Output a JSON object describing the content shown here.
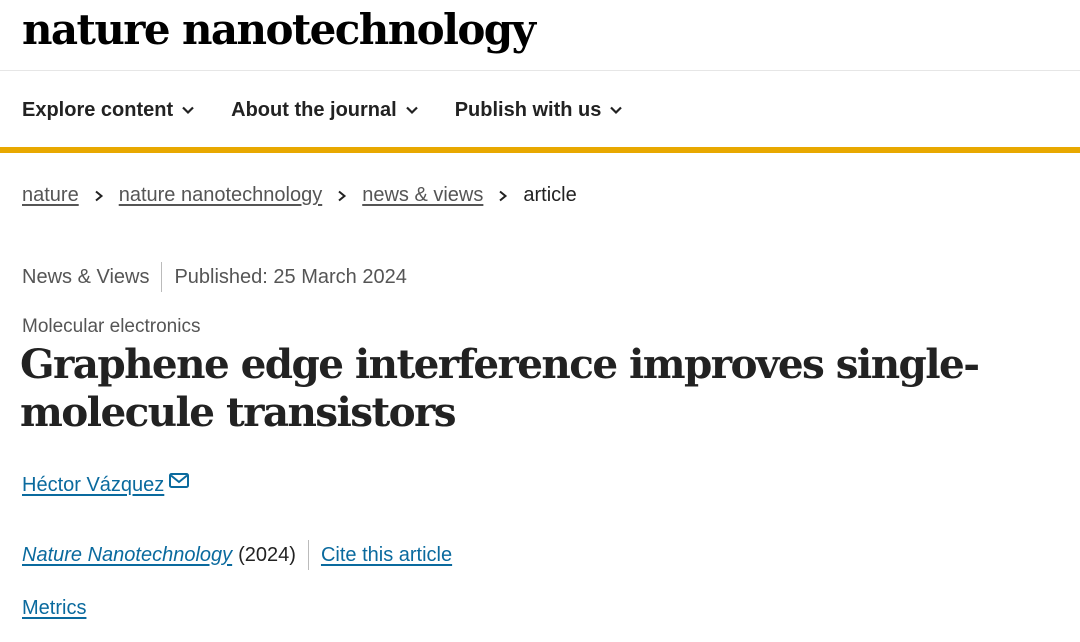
{
  "header": {
    "logo": "nature nanotechnology"
  },
  "nav": {
    "items": [
      {
        "label": "Explore content"
      },
      {
        "label": "About the journal"
      },
      {
        "label": "Publish with us"
      }
    ]
  },
  "breadcrumb": {
    "links": [
      "nature",
      "nature nanotechnology",
      "news & views"
    ],
    "current": "article"
  },
  "article": {
    "type": "News & Views",
    "published": "Published: 25 March 2024",
    "subject": "Molecular electronics",
    "title": "Graphene edge interference improves single-molecule transistors",
    "author": "Héctor Vázquez",
    "journal": "Nature Nanotechnology",
    "year": "(2024)",
    "cite_label": "Cite this article",
    "metrics_label": "Metrics"
  },
  "colors": {
    "accent": "#e8a800",
    "link": "#0a6a9e",
    "text": "#222222",
    "muted": "#555555"
  }
}
